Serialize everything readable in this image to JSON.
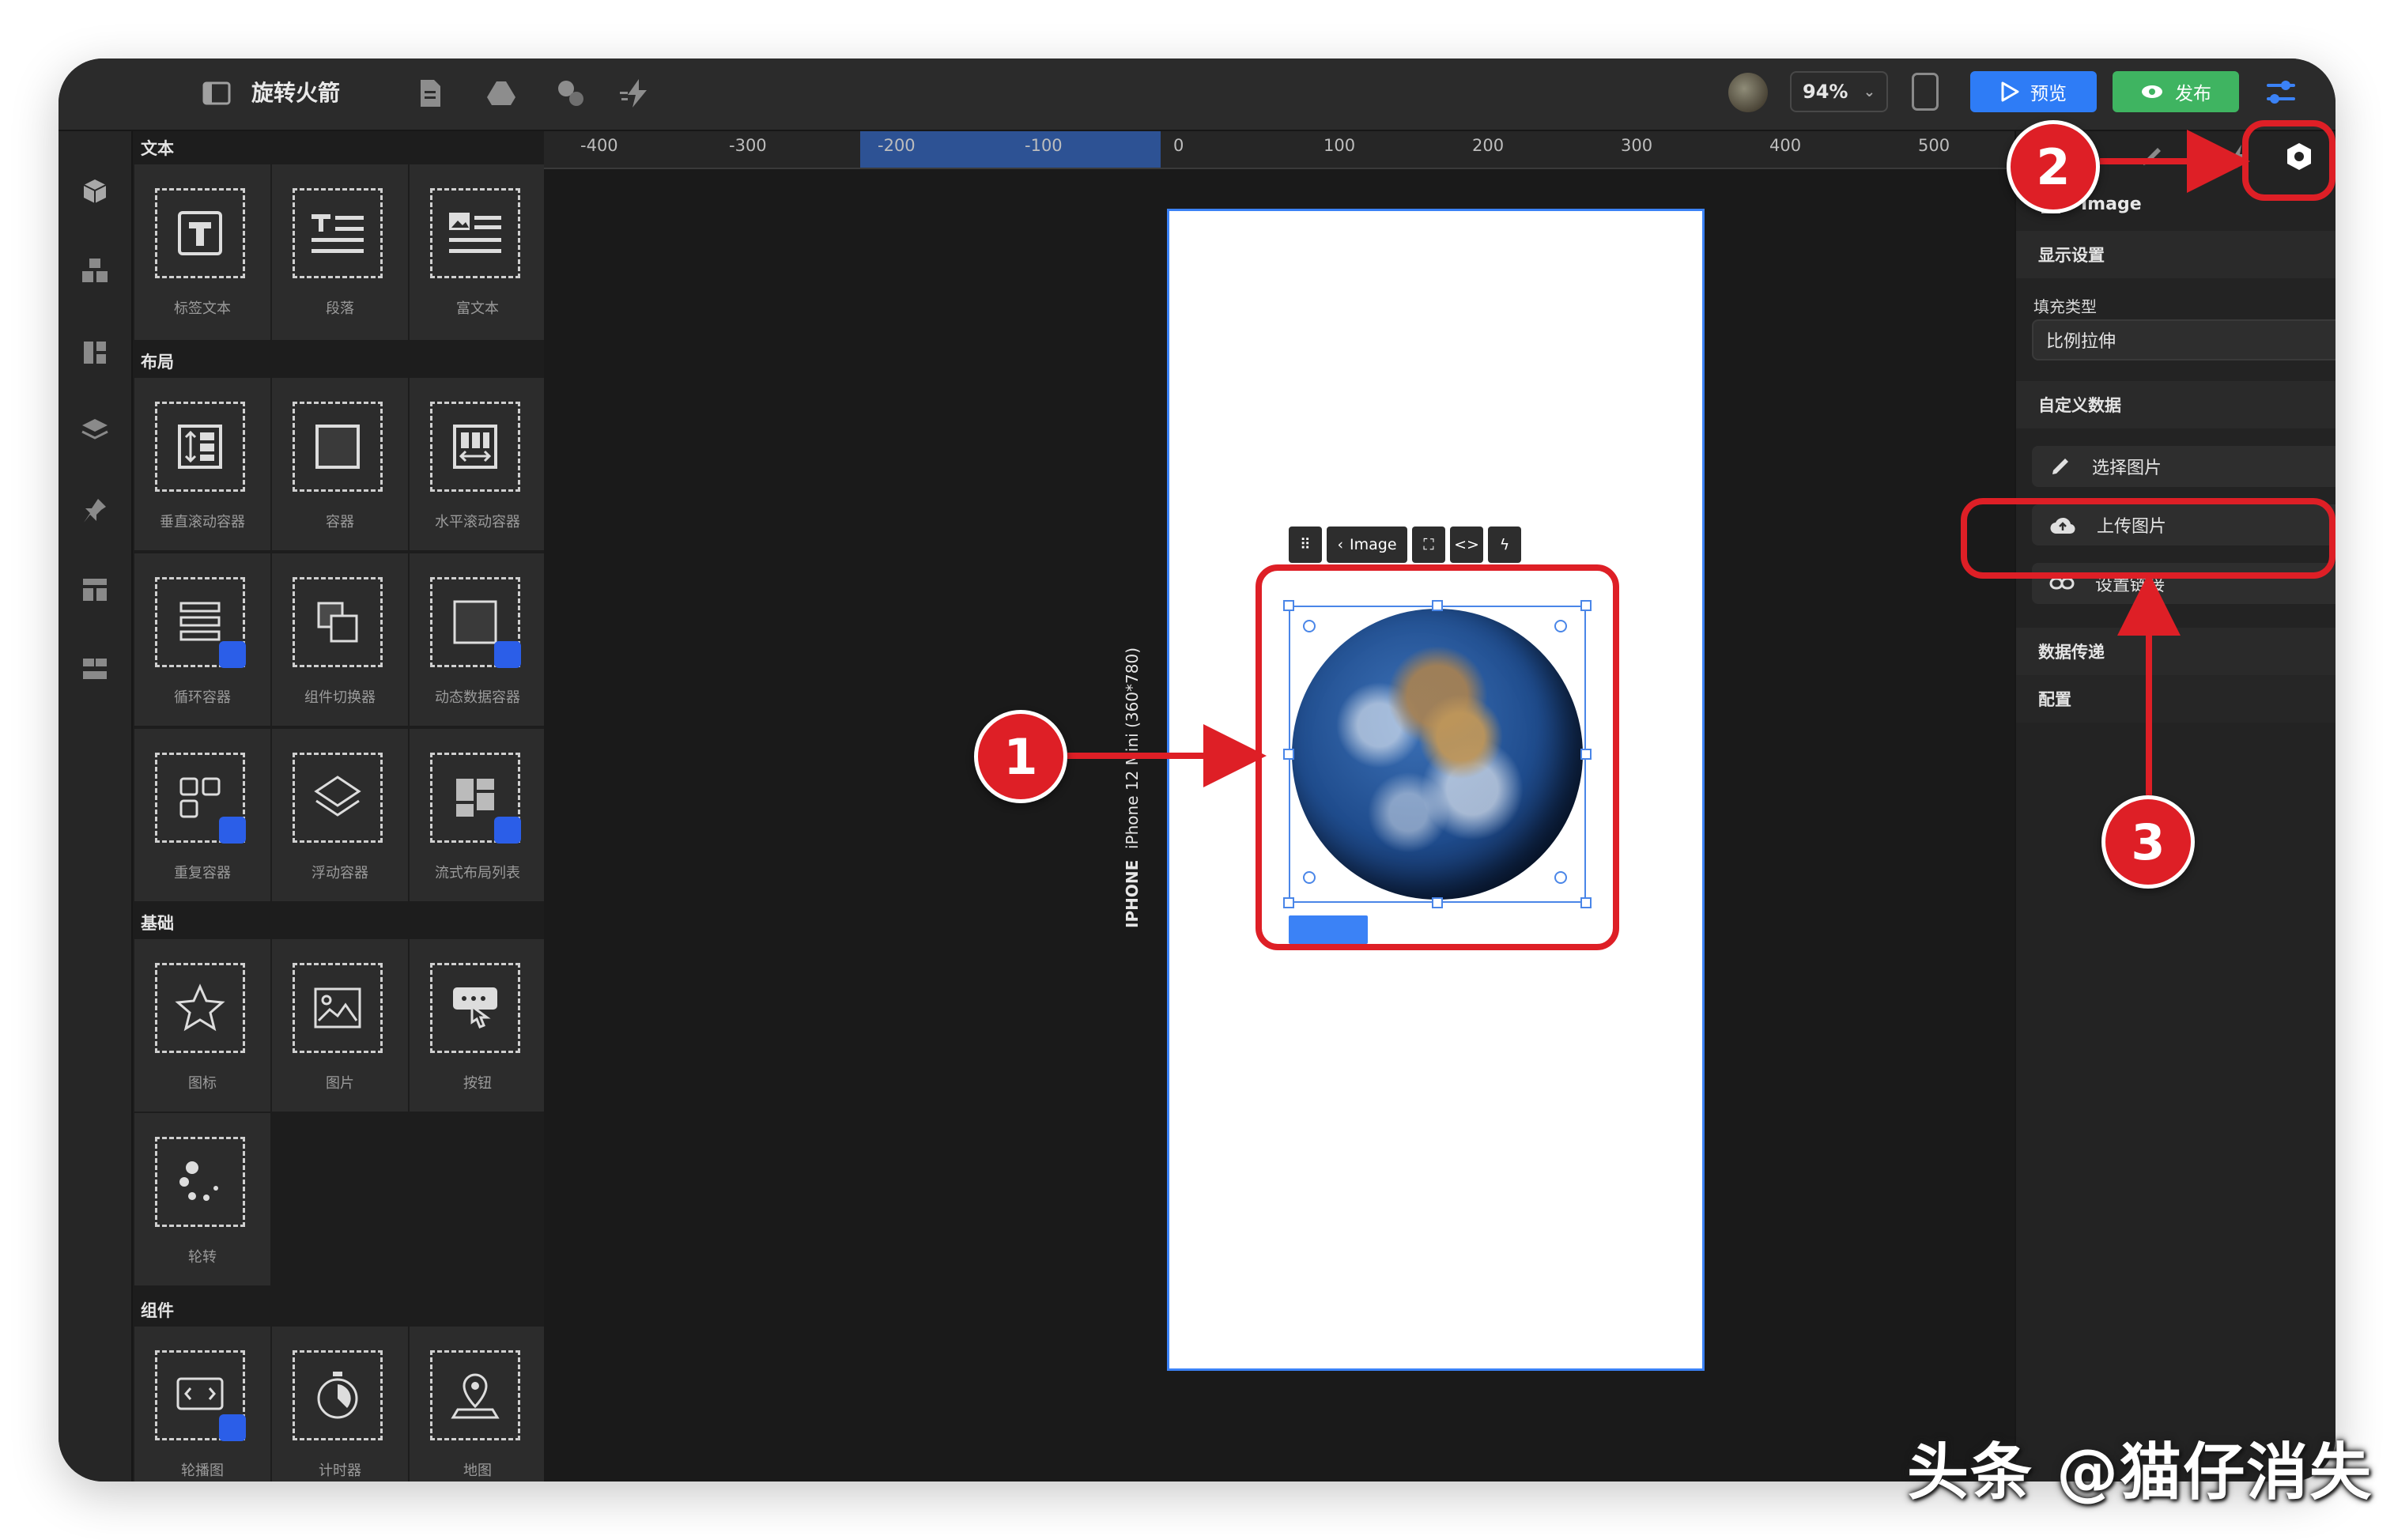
{
  "app": {
    "title": "旋转火箭",
    "zoom": "94%",
    "preview_label": "预览",
    "publish_label": "发布"
  },
  "ruler": {
    "ticks": [
      "-400",
      "-300",
      "-200",
      "-100",
      "0",
      "100",
      "200",
      "300",
      "400",
      "500"
    ]
  },
  "panel": {
    "sections": [
      {
        "title": "文本",
        "items": [
          "标签文本",
          "段落",
          "富文本"
        ]
      },
      {
        "title": "布局",
        "items": [
          "垂直滚动容器",
          "容器",
          "水平滚动容器",
          "循环容器",
          "组件切换器",
          "动态数据容器",
          "重复容器",
          "浮动容器",
          "流式布局列表"
        ]
      },
      {
        "title": "基础",
        "items": [
          "图标",
          "图片",
          "按钮",
          "轮转"
        ]
      },
      {
        "title": "组件",
        "items": [
          "轮播图",
          "计时器",
          "地图"
        ]
      }
    ]
  },
  "canvas": {
    "device_label": "iPhone 12 Mini (360*780)",
    "device_type": "IPHONE",
    "selected_component": "Image",
    "toolbar_label": "Image"
  },
  "inspector": {
    "component_name": "Image",
    "display_settings": "显示设置",
    "fill_type_label": "填充类型",
    "fill_type_value": "比例拉伸",
    "custom_data": "自定义数据",
    "choose_image": "选择图片",
    "upload_image": "上传图片",
    "set_link": "设置链接",
    "data_transfer": "数据传递",
    "config": "配置"
  },
  "annotations": {
    "badge1": "1",
    "badge2": "2",
    "badge3": "3",
    "accent_color": "#de1f26"
  },
  "watermark": "头条 @猫仔消失"
}
